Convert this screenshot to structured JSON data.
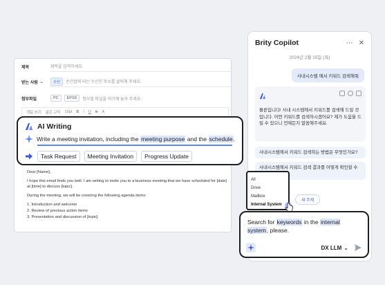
{
  "editor": {
    "subject_label": "제목",
    "subject_placeholder": "제목을 입력하세요.",
    "cc_label": "받는 사람",
    "cc_tag": "수신",
    "cc_placeholder": "손간접에 되는 수신인 주소를 클릭해 주세요.",
    "attach_label": "첨부파일",
    "attach_pc": "PC",
    "attach_epss": "EPSS",
    "attach_hint": "첨부할 파일을 여기에 놓아 주세요.",
    "toolbar_items": [
      "개일 쓰기",
      "굴은 고딕",
      "10pt",
      "B",
      "I",
      "U",
      "S",
      "A"
    ],
    "body": [
      "Dear [Name],",
      "I hope this email finds you well. I am writing to invite you to a business meeting that we have scheduled for [date] at [time] to discuss [topic].",
      "During the meeting, we will be covering the following agenda items:",
      "1. Introduction and welcome",
      "2. Review of previous action items",
      "3. Presentation and discussion of [topic]"
    ]
  },
  "ai_writing": {
    "title": "AI Writing",
    "prompt_before": "Write a meeting invitation, including the ",
    "prompt_hl1": "meeting purpose",
    "prompt_mid": " and the ",
    "prompt_hl2": "schedule",
    "prompt_after": ".",
    "chips": [
      "Task Request",
      "Meeting Invitation",
      "Progress Update"
    ]
  },
  "copilot": {
    "title": "Brity Copilot",
    "date": "2024년 2월 15일 (목)",
    "user_msg": "사내시스템 에서 키워드 검색해줘",
    "bot_reply": "물론입니다! 사내 시스템에서 키워드를 검색해 드릴 것입니다. 어떤 키워드를 검색하시겠어요? 제가 도움을 드릴 수 있으니 언제든지 말씀해주세요.",
    "suggestion_1": "사내시스템에서 키워드 검색하는 방법은 무엇인가요?",
    "suggestion_2": "사내시스템에서 키워드 검색 결과를 어떻게 확인할 수 있나요?",
    "new_topic": "새 주제",
    "dropdown": [
      "All",
      "Drive",
      "Mailbox",
      "Internal System"
    ],
    "dropdown_selected": "Internal System",
    "input_before": "Search for ",
    "input_hl1": "keywords",
    "input_mid": " in the ",
    "input_hl2": "internal system",
    "input_after": ", please.",
    "llm": "DX LLM"
  },
  "colors": {
    "accent": "#3b5bdb",
    "highlight": "#dbe6fd",
    "outline": "#1c1f26"
  }
}
